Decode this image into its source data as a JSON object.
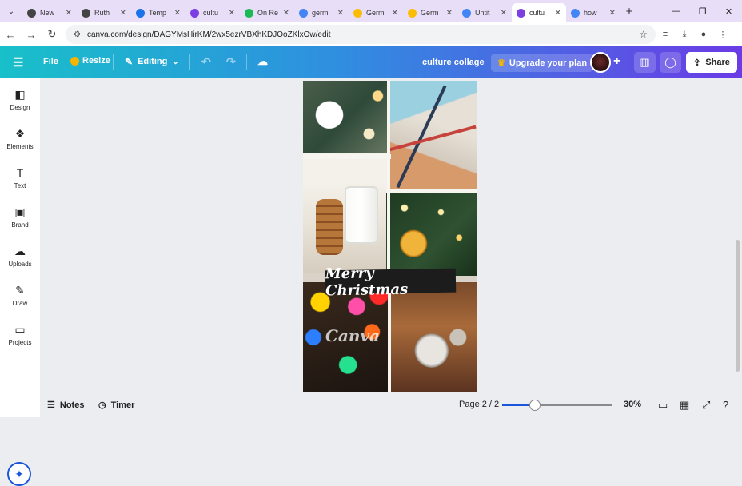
{
  "browser": {
    "tabs": [
      {
        "label": "New",
        "favicon_color": "#444444"
      },
      {
        "label": "Ruth",
        "favicon_color": "#444444"
      },
      {
        "label": "Temp",
        "favicon_color": "#1a73e8"
      },
      {
        "label": "cultu",
        "favicon_color": "#7b3fe4"
      },
      {
        "label": "On Re",
        "favicon_color": "#1db954"
      },
      {
        "label": "germ",
        "favicon_color": "#4285f4"
      },
      {
        "label": "Germ",
        "favicon_color": "#fbbc04"
      },
      {
        "label": "Germ",
        "favicon_color": "#fbbc04"
      },
      {
        "label": "Untit",
        "favicon_color": "#4285f4"
      },
      {
        "label": "cultu",
        "favicon_color": "#7b3fe4"
      },
      {
        "label": "how",
        "favicon_color": "#4285f4"
      }
    ],
    "active_tab_index": 9,
    "url": "canva.com/design/DAGYMsHirKM/2wx5ezrVBXhKDJOoZKlxOw/edit"
  },
  "canva_header": {
    "file_label": "File",
    "resize_label": "Resize",
    "editing_label": "Editing",
    "design_title": "culture collage",
    "upgrade_label": "Upgrade your plan",
    "share_label": "Share"
  },
  "sidebar": {
    "items": [
      {
        "label": "Design",
        "icon": "design-icon"
      },
      {
        "label": "Elements",
        "icon": "elements-icon"
      },
      {
        "label": "Text",
        "icon": "text-icon"
      },
      {
        "label": "Brand",
        "icon": "brand-icon"
      },
      {
        "label": "Uploads",
        "icon": "uploads-icon"
      },
      {
        "label": "Draw",
        "icon": "draw-icon"
      },
      {
        "label": "Projects",
        "icon": "projects-icon"
      }
    ]
  },
  "canvas": {
    "banner_text": "Merry Christmas",
    "watermark_text": "Canva"
  },
  "bottom_bar": {
    "notes_label": "Notes",
    "timer_label": "Timer",
    "page_indicator": "Page 2 / 2",
    "zoom_level": "30%",
    "zoom_fraction": 0.3
  },
  "colors": {
    "header_gradient_start": "#18c0c9",
    "header_gradient_end": "#6b3be6",
    "accent": "#1a56db"
  }
}
